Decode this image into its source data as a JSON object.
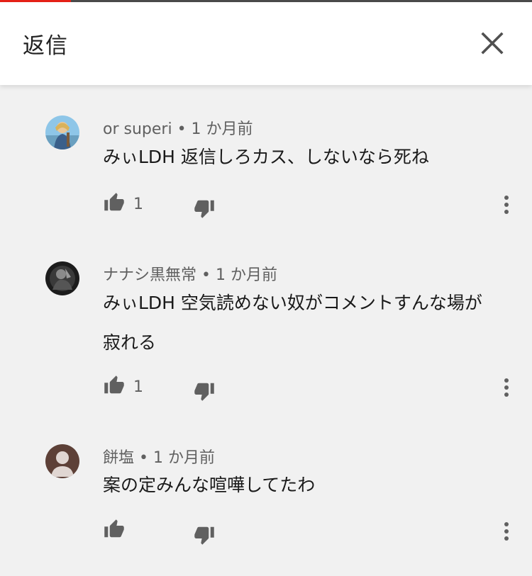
{
  "header": {
    "title": "返信",
    "close_icon": "close-icon"
  },
  "colors": {
    "header_bg": "#ffffff",
    "page_bg": "#f1f1f1",
    "progress_red": "#e62117",
    "icon_gray": "#606060"
  },
  "comments": [
    {
      "author": "or superi",
      "time": "1 か月前",
      "text": "みぃLDH 返信しろカス、しないなら死ね",
      "likes": "1"
    },
    {
      "author": "ナナシ黒無常",
      "time": "1 か月前",
      "text": "みぃLDH 空気読めない奴がコメントすんな場が寂れる",
      "likes": "1"
    },
    {
      "author": "餅塩",
      "time": "1 か月前",
      "text": "案の定みんな喧嘩してたわ",
      "likes": ""
    }
  ]
}
